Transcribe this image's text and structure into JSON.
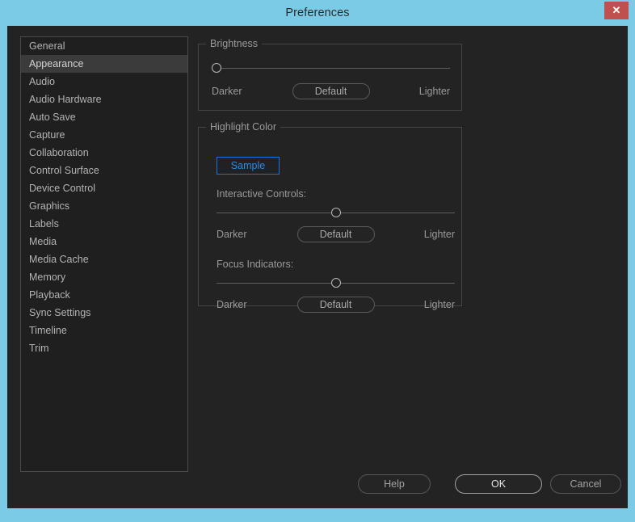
{
  "window": {
    "title": "Preferences",
    "close_label": "✕",
    "frame_color": "#7ccbe6",
    "body_color": "#232323"
  },
  "sidebar": {
    "items": [
      {
        "label": "General",
        "selected": false
      },
      {
        "label": "Appearance",
        "selected": true
      },
      {
        "label": "Audio",
        "selected": false
      },
      {
        "label": "Audio Hardware",
        "selected": false
      },
      {
        "label": "Auto Save",
        "selected": false
      },
      {
        "label": "Capture",
        "selected": false
      },
      {
        "label": "Collaboration",
        "selected": false
      },
      {
        "label": "Control Surface",
        "selected": false
      },
      {
        "label": "Device Control",
        "selected": false
      },
      {
        "label": "Graphics",
        "selected": false
      },
      {
        "label": "Labels",
        "selected": false
      },
      {
        "label": "Media",
        "selected": false
      },
      {
        "label": "Media Cache",
        "selected": false
      },
      {
        "label": "Memory",
        "selected": false
      },
      {
        "label": "Playback",
        "selected": false
      },
      {
        "label": "Sync Settings",
        "selected": false
      },
      {
        "label": "Timeline",
        "selected": false
      },
      {
        "label": "Trim",
        "selected": false
      }
    ]
  },
  "brightness": {
    "group_title": "Brightness",
    "slider_percent": 0,
    "darker_label": "Darker",
    "default_label": "Default",
    "lighter_label": "Lighter"
  },
  "highlight_color": {
    "group_title": "Highlight Color",
    "sample_label": "Sample",
    "sample_accent": "#1473e6",
    "interactive": {
      "label": "Interactive Controls:",
      "slider_percent": 50,
      "darker_label": "Darker",
      "default_label": "Default",
      "lighter_label": "Lighter"
    },
    "focus": {
      "label": "Focus Indicators:",
      "slider_percent": 50,
      "darker_label": "Darker",
      "default_label": "Default",
      "lighter_label": "Lighter"
    }
  },
  "footer": {
    "help_label": "Help",
    "ok_label": "OK",
    "cancel_label": "Cancel"
  }
}
